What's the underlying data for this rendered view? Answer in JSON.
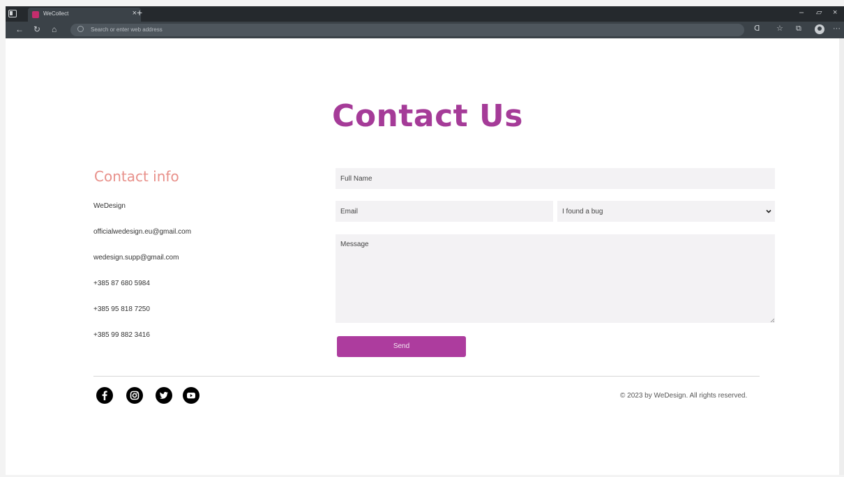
{
  "browser": {
    "tab_title": "WeCollect",
    "tab_close": "×",
    "new_tab": "+",
    "address_placeholder": "Search or enter web address",
    "minimize": "–",
    "restore": "▱",
    "close": "×",
    "more": "···"
  },
  "page": {
    "title": "Contact Us"
  },
  "contact_info": {
    "heading": "Contact info",
    "company": "WeDesign",
    "emails": [
      "officialwedesign.eu@gmail.com",
      "wedesign.supp@gmail.com"
    ],
    "phones": [
      "+385 87 680 5984",
      "+385 95 818 7250",
      "+385 99 882 3416"
    ]
  },
  "form": {
    "full_name_placeholder": "Full Name",
    "email_placeholder": "Email",
    "topic_selected": "I found a bug",
    "message_placeholder": "Message",
    "send_label": "Send"
  },
  "footer": {
    "social": [
      "facebook-icon",
      "instagram-icon",
      "twitter-icon",
      "youtube-icon"
    ],
    "copyright": "© 2023 by WeDesign. All rights reserved."
  },
  "colors": {
    "accent": "#ad3c9e",
    "heading_pink": "#e8908a",
    "field_bg": "#f3f2f4"
  }
}
